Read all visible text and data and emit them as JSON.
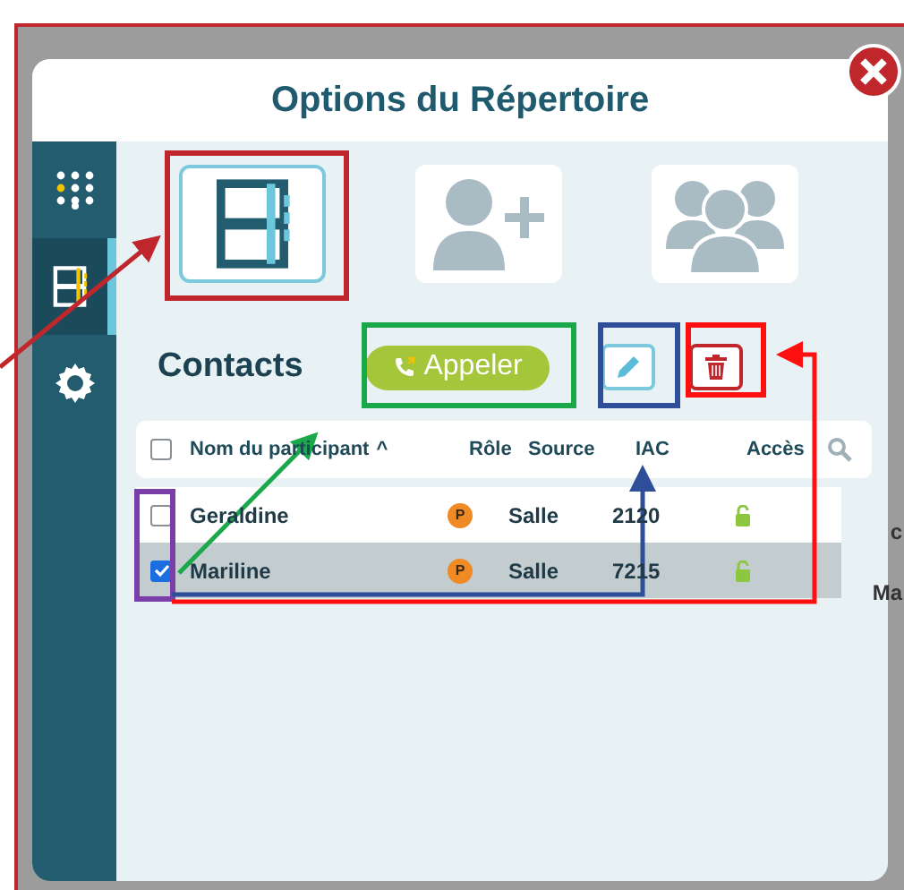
{
  "window": {
    "title": "Options du Répertoire"
  },
  "sidebar": {
    "items": [
      {
        "kind": "keypad",
        "selected": false
      },
      {
        "kind": "directory",
        "selected": true
      },
      {
        "kind": "settings",
        "selected": false
      }
    ]
  },
  "tiles": [
    {
      "kind": "directory",
      "selected": true
    },
    {
      "kind": "add-contact",
      "selected": false
    },
    {
      "kind": "groups",
      "selected": false
    }
  ],
  "section": {
    "title": "Contacts",
    "call_button": "Appeler"
  },
  "table": {
    "columns": [
      "Nom du participant",
      "Rôle",
      "Source",
      "IAC",
      "Accès"
    ],
    "sort_caret": "^",
    "all_checked": false,
    "rows": [
      {
        "checked": false,
        "selected": false,
        "name": "Geraldine",
        "role": "P",
        "source": "Salle",
        "iac": "2120",
        "unlocked": true
      },
      {
        "checked": true,
        "selected": true,
        "name": "Mariline",
        "role": "P",
        "source": "Salle",
        "iac": "7215",
        "unlocked": true
      }
    ]
  },
  "background_text": [
    "c",
    "Ma"
  ]
}
